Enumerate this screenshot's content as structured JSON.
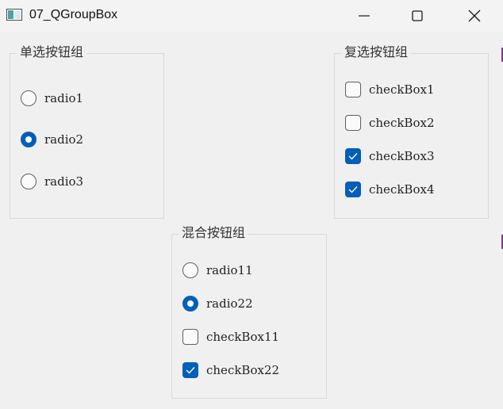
{
  "window": {
    "title": "07_QGroupBox"
  },
  "groups": {
    "single": {
      "title": "单选按钮组",
      "options": [
        {
          "label": "radio1",
          "checked": false
        },
        {
          "label": "radio2",
          "checked": true
        },
        {
          "label": "radio3",
          "checked": false
        }
      ]
    },
    "multi": {
      "title": "复选按钮组",
      "options": [
        {
          "label": "checkBox1",
          "checked": false
        },
        {
          "label": "checkBox2",
          "checked": false
        },
        {
          "label": "checkBox3",
          "checked": true
        },
        {
          "label": "checkBox4",
          "checked": true
        }
      ]
    },
    "mixed": {
      "title": "混合按钮组",
      "options": [
        {
          "kind": "radio",
          "label": "radio11",
          "checked": false
        },
        {
          "kind": "radio",
          "label": "radio22",
          "checked": true
        },
        {
          "kind": "checkbox",
          "label": "checkBox11",
          "checked": false
        },
        {
          "kind": "checkbox",
          "label": "checkBox22",
          "checked": true
        }
      ]
    }
  },
  "colors": {
    "accent": "#005fb8",
    "background": "#f0f0f0",
    "border": "#d9d9d9"
  },
  "icons": {
    "app": "window-app-icon",
    "minimize": "minimize-icon",
    "maximize": "maximize-icon",
    "close": "close-icon",
    "check": "checkmark-icon"
  }
}
